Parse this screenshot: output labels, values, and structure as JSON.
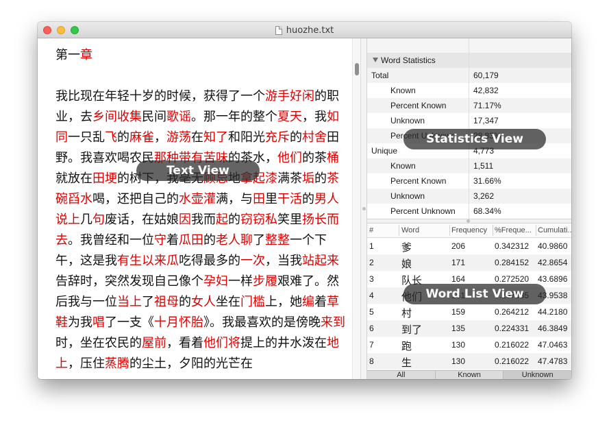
{
  "window": {
    "title": "huozhe.txt"
  },
  "text_view": {
    "chapter_title": [
      {
        "t": "第一",
        "hl": false
      },
      {
        "t": "章",
        "hl": true
      }
    ],
    "paragraph": [
      {
        "t": "我比现在年轻十岁的时候，获得了一个",
        "hl": false
      },
      {
        "t": "游手好闲",
        "hl": true
      },
      {
        "t": "的职业，去",
        "hl": false
      },
      {
        "t": "乡间收集",
        "hl": true
      },
      {
        "t": "民间",
        "hl": false
      },
      {
        "t": "歌谣",
        "hl": true
      },
      {
        "t": "。那一年的整个",
        "hl": false
      },
      {
        "t": "夏天",
        "hl": true
      },
      {
        "t": "，我",
        "hl": false
      },
      {
        "t": "如同",
        "hl": true
      },
      {
        "t": "一只乱",
        "hl": false
      },
      {
        "t": "飞",
        "hl": true
      },
      {
        "t": "的",
        "hl": false
      },
      {
        "t": "麻雀",
        "hl": true
      },
      {
        "t": "，",
        "hl": false
      },
      {
        "t": "游荡",
        "hl": true
      },
      {
        "t": "在",
        "hl": false
      },
      {
        "t": "知了",
        "hl": true
      },
      {
        "t": "和阳光",
        "hl": false
      },
      {
        "t": "充斥",
        "hl": true
      },
      {
        "t": "的",
        "hl": false
      },
      {
        "t": "村舍",
        "hl": true
      },
      {
        "t": "田野。我喜欢喝农民",
        "hl": false
      },
      {
        "t": "那种带有苦味",
        "hl": true
      },
      {
        "t": "的茶水，",
        "hl": false
      },
      {
        "t": "他们",
        "hl": true
      },
      {
        "t": "的茶",
        "hl": false
      },
      {
        "t": "桶",
        "hl": true
      },
      {
        "t": "就放在",
        "hl": false
      },
      {
        "t": "田埂",
        "hl": true
      },
      {
        "t": "的树下，我毫无",
        "hl": false
      },
      {
        "t": "顾忌",
        "hl": true
      },
      {
        "t": "地",
        "hl": false
      },
      {
        "t": "拿起漆",
        "hl": true
      },
      {
        "t": "满茶",
        "hl": false
      },
      {
        "t": "垢",
        "hl": true
      },
      {
        "t": "的",
        "hl": false
      },
      {
        "t": "茶碗舀水",
        "hl": true
      },
      {
        "t": "喝，还把自己的",
        "hl": false
      },
      {
        "t": "水壶灌",
        "hl": true
      },
      {
        "t": "满，与",
        "hl": false
      },
      {
        "t": "田",
        "hl": true
      },
      {
        "t": "里",
        "hl": false
      },
      {
        "t": "干活",
        "hl": true
      },
      {
        "t": "的",
        "hl": false
      },
      {
        "t": "男人说上",
        "hl": true
      },
      {
        "t": "几",
        "hl": false
      },
      {
        "t": "句",
        "hl": true
      },
      {
        "t": "废话，在姑娘",
        "hl": false
      },
      {
        "t": "因",
        "hl": true
      },
      {
        "t": "我而",
        "hl": false
      },
      {
        "t": "起",
        "hl": true
      },
      {
        "t": "的",
        "hl": false
      },
      {
        "t": "窃窃私",
        "hl": true
      },
      {
        "t": "笑里",
        "hl": false
      },
      {
        "t": "扬长而去",
        "hl": true
      },
      {
        "t": "。我曾经和一位",
        "hl": false
      },
      {
        "t": "守",
        "hl": true
      },
      {
        "t": "着",
        "hl": false
      },
      {
        "t": "瓜田",
        "hl": true
      },
      {
        "t": "的",
        "hl": false
      },
      {
        "t": "老人聊",
        "hl": true
      },
      {
        "t": "了",
        "hl": false
      },
      {
        "t": "整整",
        "hl": true
      },
      {
        "t": "一个下午，这是我",
        "hl": false
      },
      {
        "t": "有生以来瓜",
        "hl": true
      },
      {
        "t": "吃得最多的",
        "hl": false
      },
      {
        "t": "一次",
        "hl": true
      },
      {
        "t": "，当我",
        "hl": false
      },
      {
        "t": "站起来",
        "hl": true
      },
      {
        "t": "告辞时，突然发现自己像个",
        "hl": false
      },
      {
        "t": "孕妇",
        "hl": true
      },
      {
        "t": "一样",
        "hl": false
      },
      {
        "t": "步履",
        "hl": true
      },
      {
        "t": "艰难了。然后我与一位",
        "hl": false
      },
      {
        "t": "当上",
        "hl": true
      },
      {
        "t": "了",
        "hl": false
      },
      {
        "t": "祖母",
        "hl": true
      },
      {
        "t": "的",
        "hl": false
      },
      {
        "t": "女人",
        "hl": true
      },
      {
        "t": "坐在",
        "hl": false
      },
      {
        "t": "门槛",
        "hl": true
      },
      {
        "t": "上，她",
        "hl": false
      },
      {
        "t": "编",
        "hl": true
      },
      {
        "t": "着",
        "hl": false
      },
      {
        "t": "草鞋",
        "hl": true
      },
      {
        "t": "为我",
        "hl": false
      },
      {
        "t": "唱",
        "hl": true
      },
      {
        "t": "了一支《",
        "hl": false
      },
      {
        "t": "十月怀胎",
        "hl": true
      },
      {
        "t": "》。我最喜欢的是傍晚",
        "hl": false
      },
      {
        "t": "来到",
        "hl": true
      },
      {
        "t": "时，坐在农民的",
        "hl": false
      },
      {
        "t": "屋前",
        "hl": true
      },
      {
        "t": "，看着",
        "hl": false
      },
      {
        "t": "他们将",
        "hl": true
      },
      {
        "t": "提上的井水泼在",
        "hl": false
      },
      {
        "t": "地上",
        "hl": true
      },
      {
        "t": "，压住",
        "hl": false
      },
      {
        "t": "蒸腾",
        "hl": true
      },
      {
        "t": "的尘土，夕阳的光芒在",
        "hl": false
      }
    ]
  },
  "stats": {
    "section_label": "Word Statistics",
    "rows": [
      {
        "label": "Total",
        "value": "60,179",
        "indent": false
      },
      {
        "label": "Known",
        "value": "42,832",
        "indent": true
      },
      {
        "label": "Percent Known",
        "value": "71.17%",
        "indent": true
      },
      {
        "label": "Unknown",
        "value": "17,347",
        "indent": true
      },
      {
        "label": "Percent Unknown",
        "value": "28.83%",
        "indent": true
      },
      {
        "label": "Unique",
        "value": "4,773",
        "indent": false
      },
      {
        "label": "Known",
        "value": "1,511",
        "indent": true
      },
      {
        "label": "Percent Known",
        "value": "31.66%",
        "indent": true
      },
      {
        "label": "Unknown",
        "value": "3,262",
        "indent": true
      },
      {
        "label": "Percent Unknown",
        "value": "68.34%",
        "indent": true
      }
    ]
  },
  "wordlist": {
    "headers": [
      "#",
      "Word",
      "Frequency",
      "%Freque...",
      "Cumulati..."
    ],
    "rows": [
      [
        "1",
        "爹",
        "206",
        "0.342312",
        "40.9860"
      ],
      [
        "2",
        "娘",
        "171",
        "0.284152",
        "42.8654"
      ],
      [
        "3",
        "队长",
        "164",
        "0.272520",
        "43.6896"
      ],
      [
        "4",
        "他们",
        "161",
        "0.267535",
        "43.9538"
      ],
      [
        "5",
        "村",
        "159",
        "0.264212",
        "44.2180"
      ],
      [
        "6",
        "到了",
        "135",
        "0.224331",
        "46.3849"
      ],
      [
        "7",
        "跑",
        "130",
        "0.216022",
        "47.0463"
      ],
      [
        "8",
        "生",
        "130",
        "0.216022",
        "47.4783"
      ],
      [
        "9",
        "",
        "",
        "",
        ""
      ]
    ]
  },
  "tabs": {
    "all": "All",
    "known": "Known",
    "unknown": "Unknown"
  },
  "overlays": {
    "text_view": "Text View",
    "statistics_view": "Statistics View",
    "word_list_view": "Word List View"
  },
  "colors": {
    "highlight": "#e00000",
    "overlay": "#2a2a2a"
  }
}
